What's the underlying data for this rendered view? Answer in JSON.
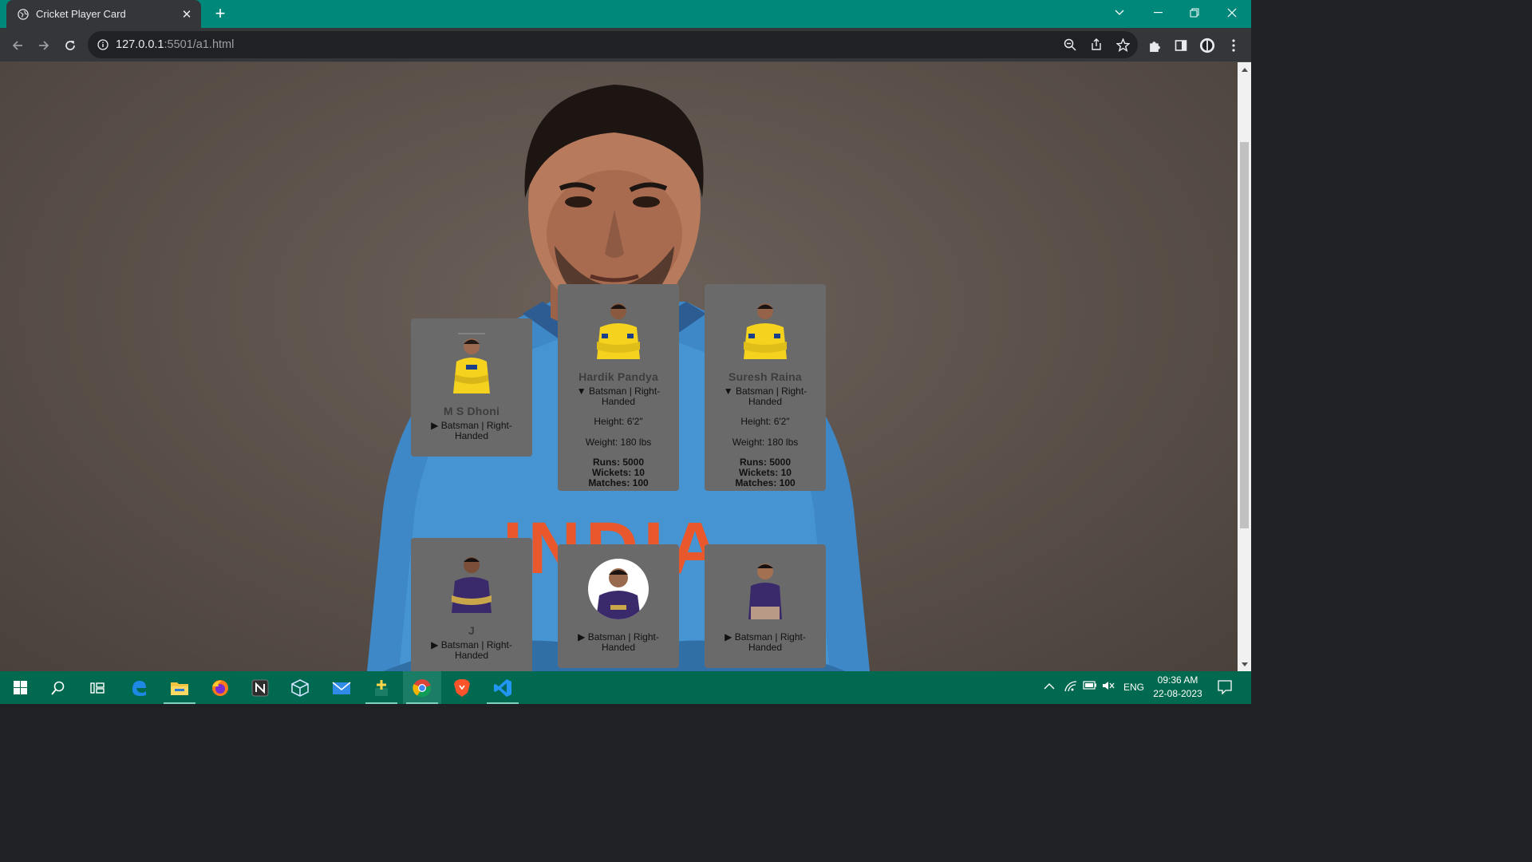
{
  "browser": {
    "tab_title": "Cricket Player Card",
    "url_host": "127.0.0.1",
    "url_path": ":5501/a1.html"
  },
  "players": [
    {
      "name": "M S Dhoni",
      "role": "Batsman | Right-Handed",
      "expanded": false,
      "jersey": "csk"
    },
    {
      "name": "Hardik Pandya",
      "role": "Batsman | Right-Handed",
      "expanded": true,
      "height": "Height: 6'2\"",
      "weight": "Weight: 180 lbs",
      "runs": "Runs: 5000",
      "wickets": "Wickets: 10",
      "matches": "Matches: 100",
      "jersey": "csk"
    },
    {
      "name": "Suresh Raina",
      "role": "Batsman | Right-Handed",
      "expanded": true,
      "height": "Height: 6'2\"",
      "weight": "Weight: 180 lbs",
      "runs": "Runs: 5000",
      "wickets": "Wickets: 10",
      "matches": "Matches: 100",
      "jersey": "csk"
    },
    {
      "name": "J",
      "role": "Batsman | Right-Handed",
      "expanded": false,
      "jersey": "kkr"
    },
    {
      "name": "",
      "role": "Batsman | Right-Handed",
      "expanded": false,
      "jersey": "kkr"
    },
    {
      "name": "",
      "role": "Batsman | Right-Handed",
      "expanded": false,
      "jersey": "kkr"
    }
  ],
  "markers": {
    "collapsed": "▶",
    "expanded": "▼"
  },
  "taskbar": {
    "language": "ENG",
    "time": "09:36 AM",
    "date": "22-08-2023"
  },
  "colors": {
    "titlebar": "#00897b",
    "taskbar": "#00694f",
    "card_bg": "#6a6a6a",
    "csk_yellow": "#f5d21e",
    "kkr_purple": "#3a2a6b"
  }
}
